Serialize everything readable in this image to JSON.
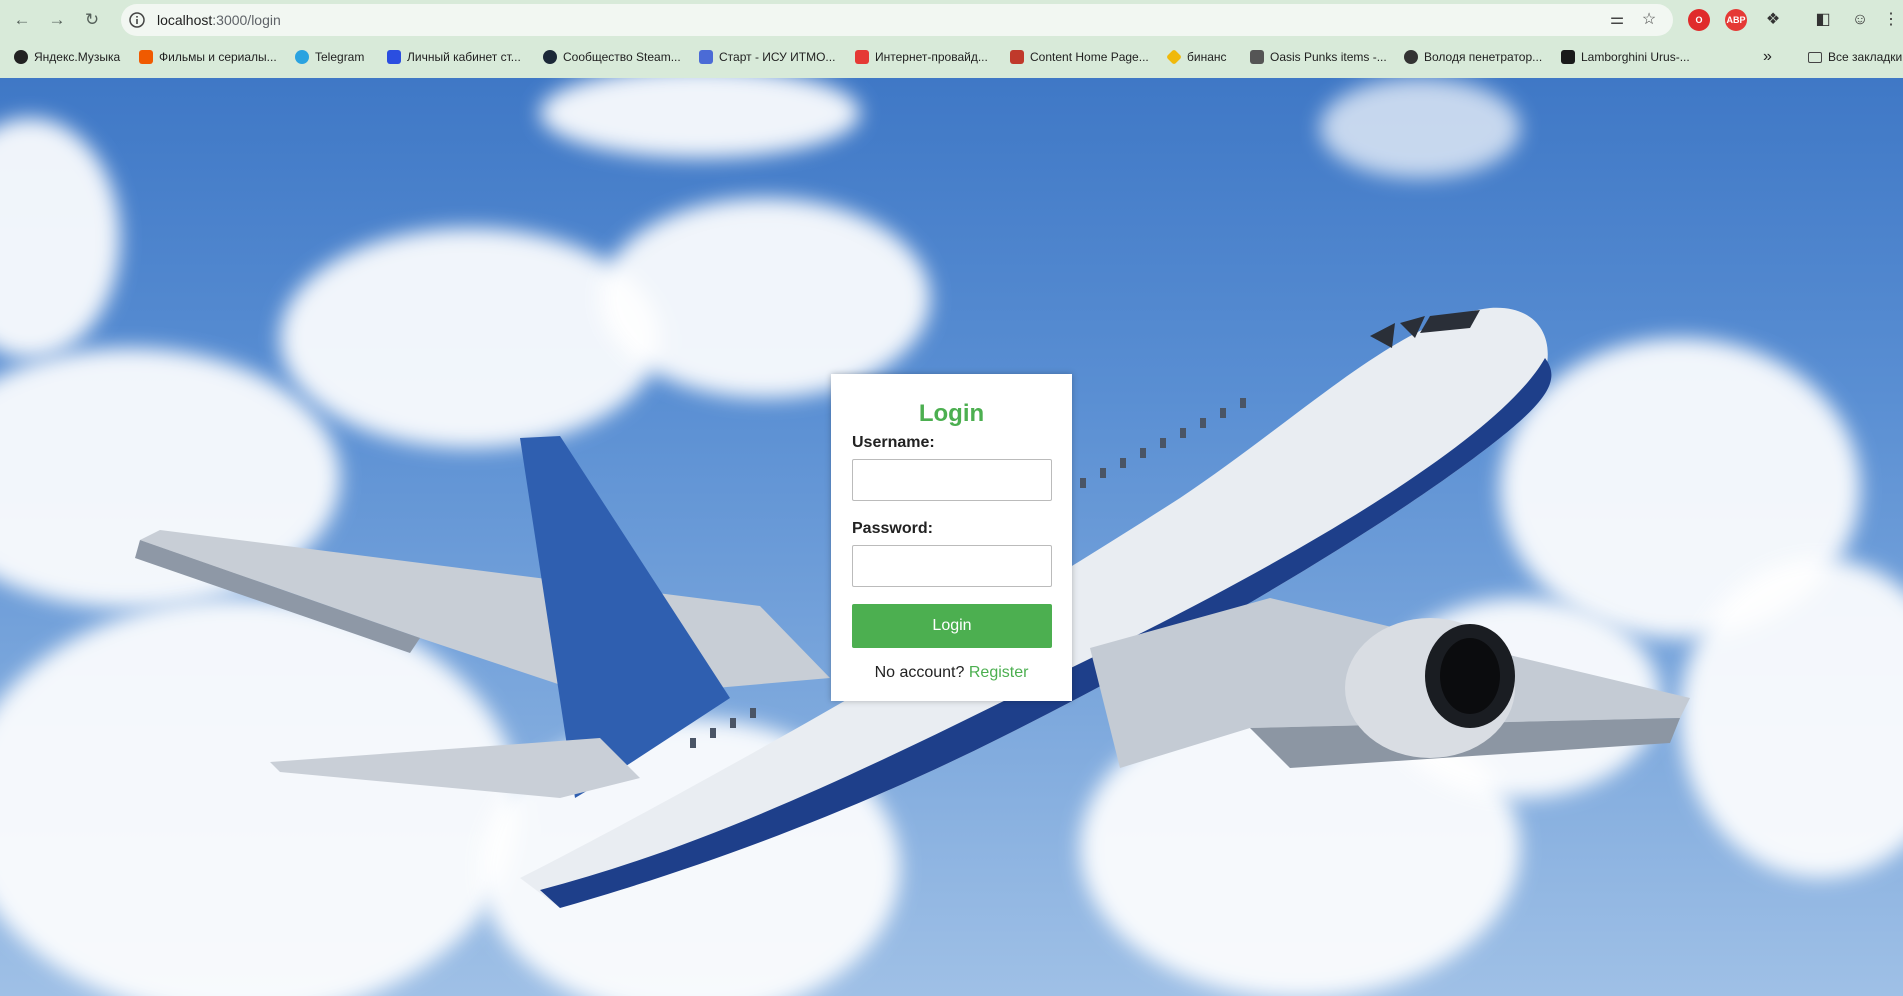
{
  "browser": {
    "url_host": "localhost",
    "url_path": ":3000/login",
    "bookmarks": [
      {
        "label": "Яндекс.Музыка",
        "color": "#222222"
      },
      {
        "label": "Фильмы и сериалы...",
        "color": "#f05a00"
      },
      {
        "label": "Telegram",
        "color": "#2aa3e0"
      },
      {
        "label": "Личный кабинет ст...",
        "color": "#2b4ee0"
      },
      {
        "label": "Сообщество Steam...",
        "color": "#1b2838"
      },
      {
        "label": "Старт - ИСУ ИТМО...",
        "color": "#4b6bd6"
      },
      {
        "label": "Интернет-провайд...",
        "color": "#e53935"
      },
      {
        "label": "Content Home Page...",
        "color": "#c0392b"
      },
      {
        "label": "бинанс",
        "color": "#f0b90b"
      },
      {
        "label": "Oasis Punks items -...",
        "color": "#555555"
      },
      {
        "label": "Володя пенетратор...",
        "color": "#333333"
      },
      {
        "label": "Lamborghini Urus-...",
        "color": "#1a1a1a"
      }
    ],
    "all_bookmarks_label": "Все закладки",
    "overflow_label": "»",
    "ext_abp_label": "ABP"
  },
  "login": {
    "title": "Login",
    "username_label": "Username:",
    "password_label": "Password:",
    "username_value": "",
    "password_value": "",
    "submit_label": "Login",
    "no_account_text": "No account?",
    "register_link": "Register",
    "accent_color": "#4caf50"
  }
}
